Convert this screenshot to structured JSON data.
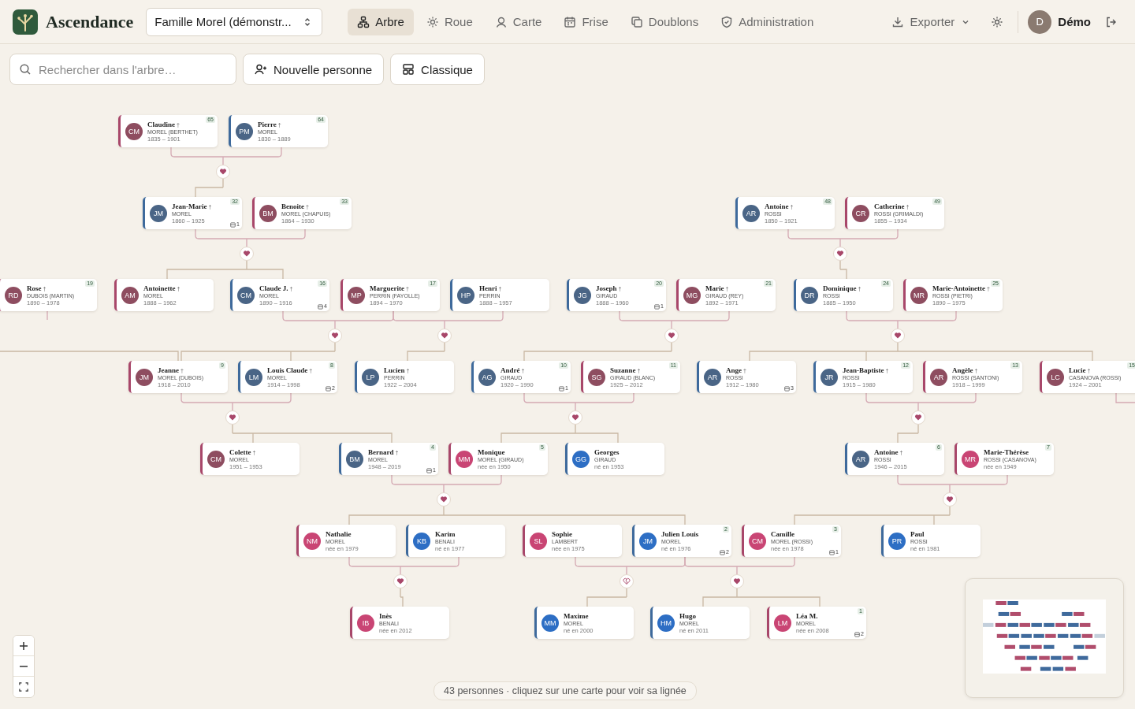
{
  "app": {
    "name": "Ascendance"
  },
  "tree_select": {
    "value": "Famille Morel (démonstr..."
  },
  "tabs": [
    {
      "label": "Arbre",
      "selected": true
    },
    {
      "label": "Roue",
      "selected": false
    },
    {
      "label": "Carte",
      "selected": false
    },
    {
      "label": "Frise",
      "selected": false
    },
    {
      "label": "Doublons",
      "selected": false
    },
    {
      "label": "Administration",
      "selected": false
    }
  ],
  "export_button": {
    "label": "Exporter"
  },
  "user": {
    "initial": "D",
    "name": "Démo"
  },
  "search": {
    "placeholder": "Rechercher dans l'arbre…"
  },
  "new_person_button": {
    "label": "Nouvelle personne"
  },
  "layout_button": {
    "label": "Classique"
  },
  "cards": [
    {
      "initials": "CM",
      "first_name": "Claudine",
      "mark": "†",
      "surname": "MOREL (BERTHET)",
      "dates": "1835 – 1901",
      "kind": "female",
      "living": false,
      "number": "65"
    },
    {
      "initials": "PM",
      "first_name": "Pierre",
      "mark": "†",
      "surname": "MOREL",
      "dates": "1830 – 1889",
      "kind": "male",
      "living": false,
      "number": "64"
    },
    {
      "initials": "JM",
      "first_name": "Jean-Marie",
      "mark": "†",
      "surname": "MOREL",
      "dates": "1860 – 1925",
      "kind": "male",
      "living": false,
      "number": "32",
      "children": "1"
    },
    {
      "initials": "BM",
      "first_name": "Benoite",
      "mark": "†",
      "surname": "MOREL (CHAPUIS)",
      "dates": "1864 – 1930",
      "kind": "female",
      "living": false,
      "number": "33"
    },
    {
      "initials": "AR",
      "first_name": "Antoine",
      "mark": "†",
      "surname": "ROSSI",
      "dates": "1850 – 1921",
      "kind": "male",
      "living": false,
      "number": "48"
    },
    {
      "initials": "CR",
      "first_name": "Catherine",
      "mark": "†",
      "surname": "ROSSI (GRIMALDI)",
      "dates": "1855 – 1934",
      "kind": "female",
      "living": false,
      "number": "49"
    },
    {
      "initials": "RD",
      "first_name": "Rose",
      "mark": "†",
      "surname": "DUBOIS (MARTIN)",
      "dates": "1890 – 1978",
      "kind": "female",
      "living": false,
      "number": "19"
    },
    {
      "initials": "AM",
      "first_name": "Antoinette",
      "mark": "†",
      "surname": "MOREL",
      "dates": "1888 – 1962",
      "kind": "female",
      "living": false
    },
    {
      "initials": "CM",
      "first_name": "Claude J.",
      "mark": "†",
      "surname": "MOREL",
      "dates": "1890 – 1916",
      "kind": "male",
      "living": false,
      "number": "16",
      "children": "4"
    },
    {
      "initials": "MP",
      "first_name": "Marguerite",
      "mark": "†",
      "surname": "PERRIN (FAYOLLE)",
      "dates": "1894 – 1970",
      "kind": "female",
      "living": false,
      "number": "17"
    },
    {
      "initials": "HP",
      "first_name": "Henri",
      "mark": "†",
      "surname": "PERRIN",
      "dates": "1888 – 1957",
      "kind": "male",
      "living": false
    },
    {
      "initials": "JG",
      "first_name": "Joseph",
      "mark": "†",
      "surname": "GIRAUD",
      "dates": "1888 – 1960",
      "kind": "male",
      "living": false,
      "number": "20",
      "children": "1"
    },
    {
      "initials": "MG",
      "first_name": "Marie",
      "mark": "†",
      "surname": "GIRAUD (REY)",
      "dates": "1892 – 1971",
      "kind": "female",
      "living": false,
      "number": "21"
    },
    {
      "initials": "DR",
      "first_name": "Dominique",
      "mark": "†",
      "surname": "ROSSI",
      "dates": "1885 – 1950",
      "kind": "male",
      "living": false,
      "number": "24"
    },
    {
      "initials": "MR",
      "first_name": "Marie-Antoinette",
      "mark": "†",
      "surname": "ROSSI (PIETRI)",
      "dates": "1890 – 1975",
      "kind": "female",
      "living": false,
      "number": "25"
    },
    {
      "initials": "JM",
      "first_name": "Jeanne",
      "mark": "†",
      "surname": "MOREL (DUBOIS)",
      "dates": "1918 – 2010",
      "kind": "female",
      "living": false,
      "number": "9"
    },
    {
      "initials": "LM",
      "first_name": "Louis Claude",
      "mark": "†",
      "surname": "MOREL",
      "dates": "1914 – 1998",
      "kind": "male",
      "living": false,
      "number": "8",
      "children": "2"
    },
    {
      "initials": "LP",
      "first_name": "Lucien",
      "mark": "†",
      "surname": "PERRIN",
      "dates": "1922 – 2004",
      "kind": "male",
      "living": false
    },
    {
      "initials": "AG",
      "first_name": "André",
      "mark": "†",
      "surname": "GIRAUD",
      "dates": "1920 – 1990",
      "kind": "male",
      "living": false,
      "number": "10",
      "children": "1"
    },
    {
      "initials": "SG",
      "first_name": "Suzanne",
      "mark": "†",
      "surname": "GIRAUD (BLANC)",
      "dates": "1925 – 2012",
      "kind": "female",
      "living": false,
      "number": "11"
    },
    {
      "initials": "AR",
      "first_name": "Ange",
      "mark": "†",
      "surname": "ROSSI",
      "dates": "1912 – 1980",
      "kind": "male",
      "living": false,
      "children": "3"
    },
    {
      "initials": "JR",
      "first_name": "Jean-Baptiste",
      "mark": "†",
      "surname": "ROSSI",
      "dates": "1915 – 1980",
      "kind": "male",
      "living": false,
      "number": "12"
    },
    {
      "initials": "AR",
      "first_name": "Angèle",
      "mark": "†",
      "surname": "ROSSI (SANTONI)",
      "dates": "1918 – 1999",
      "kind": "female",
      "living": false,
      "number": "13"
    },
    {
      "initials": "LC",
      "first_name": "Lucie",
      "mark": "†",
      "surname": "CASANOVA (ROSSI)",
      "dates": "1924 – 2001",
      "kind": "female",
      "living": false,
      "number": "15"
    },
    {
      "initials": "CM",
      "first_name": "Colette",
      "mark": "†",
      "surname": "MOREL",
      "dates": "1951 – 1953",
      "kind": "female",
      "living": false
    },
    {
      "initials": "BM",
      "first_name": "Bernard",
      "mark": "†",
      "surname": "MOREL",
      "dates": "1948 – 2019",
      "kind": "male",
      "living": false,
      "number": "4",
      "children": "1"
    },
    {
      "initials": "MM",
      "first_name": "Monique",
      "surname": "MOREL (GIRAUD)",
      "dates": "née en 1950",
      "kind": "female",
      "living": true,
      "number": "5"
    },
    {
      "initials": "GG",
      "first_name": "Georges",
      "surname": "GIRAUD",
      "dates": "né en 1953",
      "kind": "male",
      "living": true
    },
    {
      "initials": "AR",
      "first_name": "Antoine",
      "mark": "†",
      "surname": "ROSSI",
      "dates": "1946 – 2015",
      "kind": "male",
      "living": false,
      "number": "6"
    },
    {
      "initials": "MR",
      "first_name": "Marie-Thérèse",
      "surname": "ROSSI (CASANOVA)",
      "dates": "née en 1949",
      "kind": "female",
      "living": true,
      "number": "7"
    },
    {
      "initials": "NM",
      "first_name": "Nathalie",
      "surname": "MOREL",
      "dates": "née en 1979",
      "kind": "female",
      "living": true
    },
    {
      "initials": "KB",
      "first_name": "Karim",
      "surname": "BENALI",
      "dates": "né en 1977",
      "kind": "male",
      "living": true
    },
    {
      "initials": "SL",
      "first_name": "Sophie",
      "surname": "LAMBERT",
      "dates": "née en 1975",
      "kind": "female",
      "living": true
    },
    {
      "initials": "JM",
      "first_name": "Julien Louis",
      "surname": "MOREL",
      "dates": "né en 1976",
      "kind": "male",
      "living": true,
      "number": "2",
      "children": "2"
    },
    {
      "initials": "CM",
      "first_name": "Camille",
      "surname": "MOREL (ROSSI)",
      "dates": "née en 1978",
      "kind": "female",
      "living": true,
      "number": "3",
      "children": "1"
    },
    {
      "initials": "PR",
      "first_name": "Paul",
      "surname": "ROSSI",
      "dates": "né en 1981",
      "kind": "male",
      "living": true
    },
    {
      "initials": "IB",
      "first_name": "Inès",
      "surname": "BENALI",
      "dates": "née en 2012",
      "kind": "female",
      "living": true
    },
    {
      "initials": "MM",
      "first_name": "Maxime",
      "surname": "MOREL",
      "dates": "né en 2000",
      "kind": "male",
      "living": true
    },
    {
      "initials": "HM",
      "first_name": "Hugo",
      "surname": "MOREL",
      "dates": "né en 2011",
      "kind": "male",
      "living": true
    },
    {
      "initials": "LM",
      "first_name": "Léa M.",
      "surname": "MOREL",
      "dates": "née en 2008",
      "kind": "female",
      "living": true,
      "number": "1",
      "children": "2"
    }
  ],
  "unions": [
    {
      "separated": false
    },
    {
      "separated": false
    },
    {
      "separated": false
    },
    {
      "separated": false
    },
    {
      "separated": false
    },
    {
      "separated": false
    },
    {
      "separated": false
    },
    {
      "separated": false
    },
    {
      "separated": false
    },
    {
      "separated": false
    },
    {
      "separated": false
    },
    {
      "separated": false
    },
    {
      "separated": false
    },
    {
      "separated": true
    },
    {
      "separated": false
    }
  ],
  "status": {
    "text": "43 personnes · cliquez sur une carte pour voir sa lignée"
  }
}
